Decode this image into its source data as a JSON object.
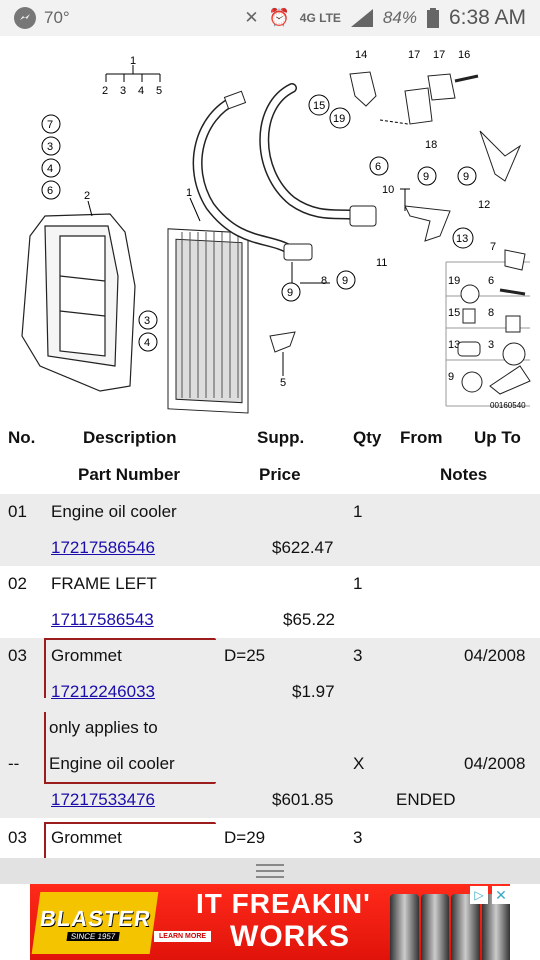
{
  "status_bar": {
    "temperature": "70°",
    "network": "4G LTE",
    "battery": "84%",
    "time": "6:38 AM"
  },
  "diagram": {
    "callouts": [
      "1",
      "2",
      "3",
      "4",
      "5",
      "14",
      "17",
      "17",
      "16",
      "15",
      "19",
      "18",
      "7",
      "3",
      "4",
      "6",
      "2",
      "1",
      "6",
      "10",
      "9",
      "9",
      "12",
      "13",
      "7",
      "11",
      "8",
      "9",
      "9",
      "3",
      "4",
      "5",
      "19",
      "6",
      "15",
      "8",
      "13",
      "3",
      "9"
    ],
    "image_code": "00160540"
  },
  "table": {
    "headers": {
      "no": "No.",
      "description": "Description",
      "supp": "Supp.",
      "qty": "Qty",
      "from": "From",
      "up_to": "Up To",
      "part_number": "Part Number",
      "price": "Price",
      "notes": "Notes"
    },
    "rows": [
      {
        "no": "01",
        "description": "Engine oil cooler",
        "supp": "",
        "qty": "1",
        "from": "",
        "up_to": "",
        "part_number": "17217586546",
        "price": "$622.47",
        "notes": ""
      },
      {
        "no": "02",
        "description": "FRAME LEFT",
        "supp": "",
        "qty": "1",
        "from": "",
        "up_to": "",
        "part_number": "17117586543",
        "price": "$65.22",
        "notes": ""
      },
      {
        "no": "03",
        "description": "Grommet",
        "supp": "D=25",
        "qty": "3",
        "from": "",
        "up_to": "04/2008",
        "part_number": "17212246033",
        "price": "$1.97",
        "notes": ""
      },
      {
        "no": "",
        "description": "only applies to",
        "supp": "",
        "qty": "",
        "from": "",
        "up_to": "",
        "part_number": "",
        "price": "",
        "notes": ""
      },
      {
        "no": "--",
        "description": "Engine oil cooler",
        "supp": "",
        "qty": "X",
        "from": "",
        "up_to": "04/2008",
        "part_number": "17217533476",
        "price": "$601.85",
        "notes": "ENDED"
      },
      {
        "no": "03",
        "description": "Grommet",
        "supp": "D=29",
        "qty": "3",
        "from": "",
        "up_to": "",
        "part_number": "",
        "price": "",
        "notes": ""
      }
    ]
  },
  "ad": {
    "brand": "BLASTER",
    "since": "SINCE 1957",
    "learn_more": "LEARN MORE",
    "line1": "IT FREAKIN'",
    "line2": "WORKS"
  }
}
